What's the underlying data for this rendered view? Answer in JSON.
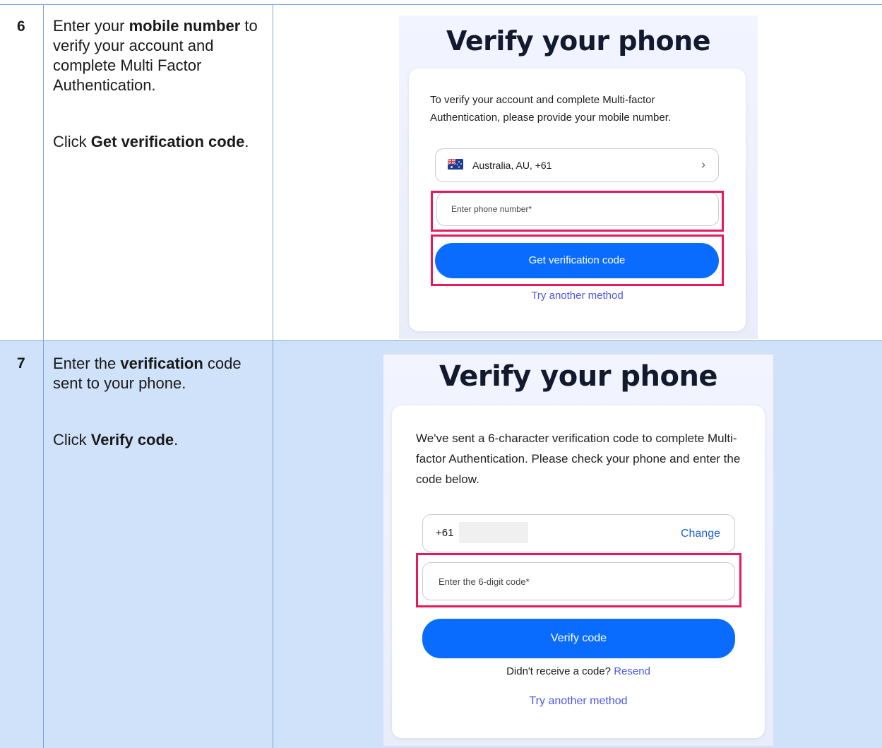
{
  "steps": [
    {
      "number": "6",
      "instruction": {
        "pre": "Enter your ",
        "bold": "mobile number",
        "post": " to verify your account and complete Multi Factor Authentication."
      },
      "action": {
        "pre": "Click ",
        "bold": "Get verification code",
        "post": "."
      },
      "screen": {
        "title": "Verify your phone",
        "description": "To verify your account and complete Multi-factor Authentication, please provide your mobile number.",
        "country_selector": "Australia, AU, +61",
        "phone_placeholder": "Enter phone number*",
        "submit_label": "Get verification code",
        "alt_method": "Try another method"
      }
    },
    {
      "number": "7",
      "instruction": {
        "pre": "Enter the ",
        "bold": "verification",
        "post": " code sent to your phone."
      },
      "action": {
        "pre": "Click ",
        "bold": "Verify code",
        "post": "."
      },
      "screen": {
        "title": "Verify your phone",
        "description": "We've sent a 6-character verification code to complete Multi-factor Authentication. Please check your phone and enter the code below.",
        "phone_prefix": "+61",
        "change_label": "Change",
        "code_placeholder": "Enter the 6-digit code*",
        "submit_label": "Verify code",
        "resend_prompt": "Didn't receive a code?",
        "resend_label": "Resend",
        "alt_method": "Try another method"
      }
    }
  ],
  "colors": {
    "accent": "#0a6cff",
    "highlight": "#e8195a",
    "link": "#4d57e6",
    "row_shade": "#cfe2fa"
  }
}
